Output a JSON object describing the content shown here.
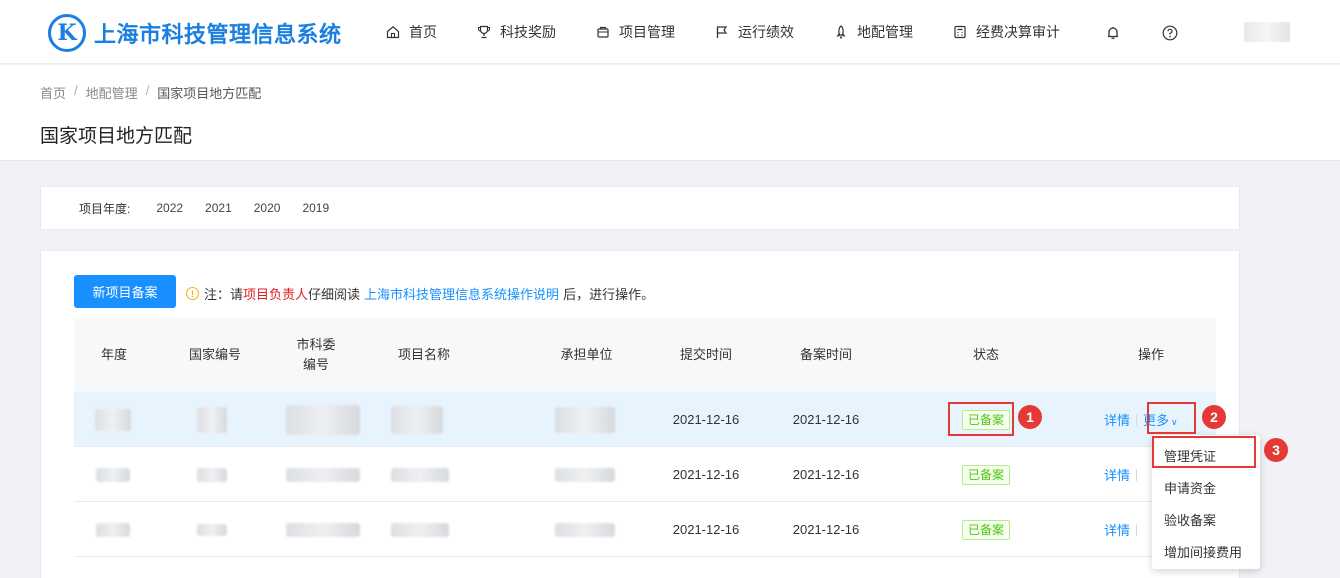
{
  "app": {
    "logo_letter": "K",
    "title": "上海市科技管理信息系统"
  },
  "nav": {
    "items": [
      {
        "label": "首页",
        "icon": "home-icon"
      },
      {
        "label": "科技奖励",
        "icon": "trophy-icon"
      },
      {
        "label": "项目管理",
        "icon": "folder-icon"
      },
      {
        "label": "运行绩效",
        "icon": "flag-icon"
      },
      {
        "label": "地配管理",
        "icon": "rocket-icon"
      },
      {
        "label": "经费决算审计",
        "icon": "calculator-icon"
      }
    ],
    "bell_icon": "bell-icon",
    "help_icon": "help-icon"
  },
  "breadcrumb": {
    "items": [
      "首页",
      "地配管理",
      "国家项目地方匹配"
    ],
    "separator": "/"
  },
  "page_title": "国家项目地方匹配",
  "year_filter": {
    "label": "项目年度:",
    "options": [
      "2022",
      "2021",
      "2020",
      "2019"
    ]
  },
  "toolbar": {
    "new_button": "新项目备案",
    "notice_prefix": "注：请",
    "notice_red": "项目负责人",
    "notice_mid": "仔细阅读",
    "notice_link": "上海市科技管理信息系统操作说明",
    "notice_suffix": "后，进行操作。"
  },
  "table": {
    "headers": [
      "年度",
      "国家编号",
      "市科委编号",
      "项目名称",
      "承担单位",
      "提交时间",
      "备案时间",
      "状态",
      "操作"
    ],
    "rows": [
      {
        "submit_time": "2021-12-16",
        "record_time": "2021-12-16",
        "status": "已备案",
        "detail": "详情",
        "more": "更多"
      },
      {
        "submit_time": "2021-12-16",
        "record_time": "2021-12-16",
        "status": "已备案",
        "detail": "详情"
      },
      {
        "submit_time": "2021-12-16",
        "record_time": "2021-12-16",
        "status": "已备案",
        "detail": "详情"
      }
    ]
  },
  "dropdown": {
    "items": [
      "管理凭证",
      "申请资金",
      "验收备案",
      "增加间接费用"
    ]
  },
  "annotations": {
    "badges": [
      "1",
      "2",
      "3"
    ],
    "color": "#e53935"
  },
  "colors": {
    "brand": "#1a7fe0",
    "primary": "#1890ff",
    "success": "#52c41a",
    "warning": "#faad14",
    "danger": "#e02020"
  }
}
